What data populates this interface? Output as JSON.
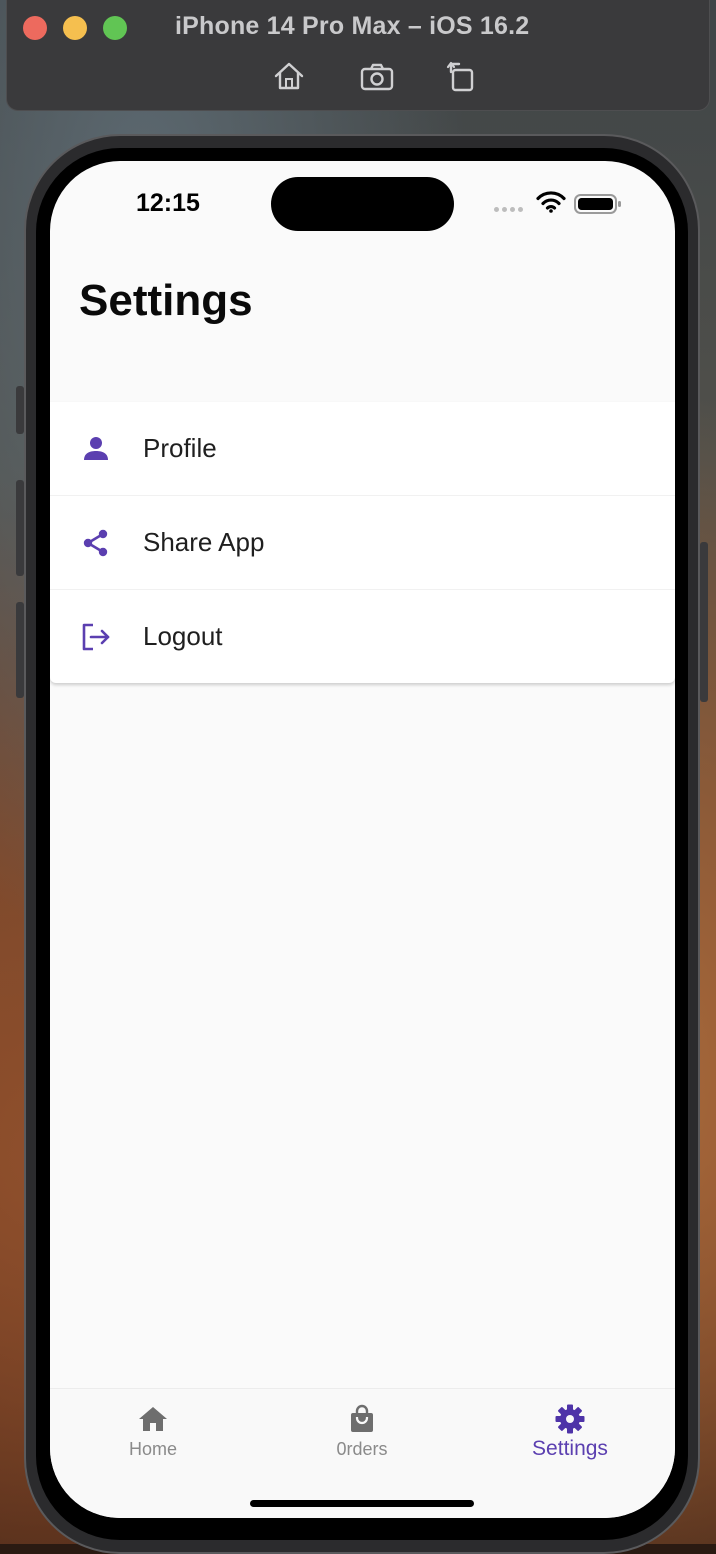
{
  "simulator": {
    "title": "iPhone 14 Pro Max – iOS 16.2",
    "buttons": [
      "home-icon",
      "screenshot-icon",
      "rotate-icon"
    ]
  },
  "status_bar": {
    "time": "12:15"
  },
  "page": {
    "title": "Settings"
  },
  "settings_items": [
    {
      "label": "Profile",
      "icon": "person-icon"
    },
    {
      "label": "Share App",
      "icon": "share-icon"
    },
    {
      "label": "Logout",
      "icon": "logout-icon"
    }
  ],
  "tabs": [
    {
      "label": "Home",
      "icon": "home-icon",
      "active": false
    },
    {
      "label": "0rders",
      "icon": "shopping-bag-icon",
      "active": false
    },
    {
      "label": "Settings",
      "icon": "gear-icon",
      "active": true
    }
  ],
  "colors": {
    "accent": "#5b3fb0",
    "inactive_tab": "#8a8a8a"
  }
}
